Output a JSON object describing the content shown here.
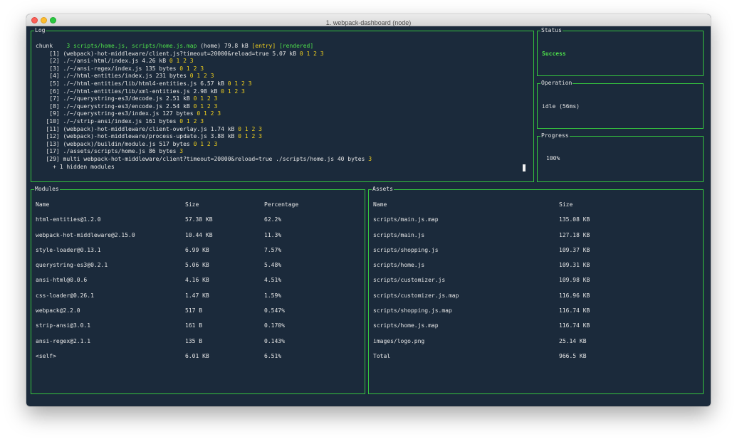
{
  "window": {
    "title": "1. webpack-dashboard (node)"
  },
  "log": {
    "label": "Log",
    "lines": [
      [
        {
          "t": "chunk    ",
          "c": "white"
        },
        {
          "t": "3 scripts/home.js, scripts/home.js.map",
          "c": "green"
        },
        {
          "t": " (home) 79.8 kB ",
          "c": "white"
        },
        {
          "t": "[entry]",
          "c": "yellow"
        },
        {
          "t": " ",
          "c": "white"
        },
        {
          "t": "[rendered]",
          "c": "green"
        }
      ],
      [
        {
          "t": "    [1] (webpack)-hot-middleware/client.js?timeout=20000&reload=true 5.07 kB ",
          "c": "white"
        },
        {
          "t": "0 1 2 3",
          "c": "yellow"
        }
      ],
      [
        {
          "t": "    [2] ./~/ansi-html/index.js 4.26 kB ",
          "c": "white"
        },
        {
          "t": "0 1 2 3",
          "c": "yellow"
        }
      ],
      [
        {
          "t": "    [3] ./~/ansi-regex/index.js 135 bytes ",
          "c": "white"
        },
        {
          "t": "0 1 2 3",
          "c": "yellow"
        }
      ],
      [
        {
          "t": "    [4] ./~/html-entities/index.js 231 bytes ",
          "c": "white"
        },
        {
          "t": "0 1 2 3",
          "c": "yellow"
        }
      ],
      [
        {
          "t": "    [5] ./~/html-entities/lib/html4-entities.js 6.57 kB ",
          "c": "white"
        },
        {
          "t": "0 1 2 3",
          "c": "yellow"
        }
      ],
      [
        {
          "t": "    [6] ./~/html-entities/lib/xml-entities.js 2.98 kB ",
          "c": "white"
        },
        {
          "t": "0 1 2 3",
          "c": "yellow"
        }
      ],
      [
        {
          "t": "    [7] ./~/querystring-es3/decode.js 2.51 kB ",
          "c": "white"
        },
        {
          "t": "0 1 2 3",
          "c": "yellow"
        }
      ],
      [
        {
          "t": "    [8] ./~/querystring-es3/encode.js 2.54 kB ",
          "c": "white"
        },
        {
          "t": "0 1 2 3",
          "c": "yellow"
        }
      ],
      [
        {
          "t": "    [9] ./~/querystring-es3/index.js 127 bytes ",
          "c": "white"
        },
        {
          "t": "0 1 2 3",
          "c": "yellow"
        }
      ],
      [
        {
          "t": "   [10] ./~/strip-ansi/index.js 161 bytes ",
          "c": "white"
        },
        {
          "t": "0 1 2 3",
          "c": "yellow"
        }
      ],
      [
        {
          "t": "   [11] (webpack)-hot-middleware/client-overlay.js 1.74 kB ",
          "c": "white"
        },
        {
          "t": "0 1 2 3",
          "c": "yellow"
        }
      ],
      [
        {
          "t": "   [12] (webpack)-hot-middleware/process-update.js 3.88 kB ",
          "c": "white"
        },
        {
          "t": "0 1 2 3",
          "c": "yellow"
        }
      ],
      [
        {
          "t": "   [13] (webpack)/buildin/module.js 517 bytes ",
          "c": "white"
        },
        {
          "t": "0 1 2 3",
          "c": "yellow"
        }
      ],
      [
        {
          "t": "   [17] ./assets/scripts/home.js 86 bytes ",
          "c": "white"
        },
        {
          "t": "3",
          "c": "yellow"
        }
      ],
      [
        {
          "t": "   [29] multi webpack-hot-middleware/client?timeout=20000&reload=true ./scripts/home.js 40 bytes ",
          "c": "white"
        },
        {
          "t": "3",
          "c": "yellow"
        }
      ],
      [
        {
          "t": "     + 1 hidden modules",
          "c": "white"
        }
      ]
    ]
  },
  "status": {
    "label": "Status",
    "value": "Success"
  },
  "operation": {
    "label": "Operation",
    "value": "idle (56ms)"
  },
  "progress": {
    "label": "Progress",
    "value": "100%"
  },
  "modules": {
    "label": "Modules",
    "headers": {
      "name": "Name",
      "size": "Size",
      "percentage": "Percentage"
    },
    "rows": [
      {
        "name": "html-entities@1.2.0",
        "size": "57.38 KB",
        "percentage": "62.2%"
      },
      {
        "name": "webpack-hot-middleware@2.15.0",
        "size": "10.44 KB",
        "percentage": "11.3%"
      },
      {
        "name": "style-loader@0.13.1",
        "size": "6.99 KB",
        "percentage": "7.57%"
      },
      {
        "name": "querystring-es3@0.2.1",
        "size": "5.06 KB",
        "percentage": "5.48%"
      },
      {
        "name": "ansi-html@0.0.6",
        "size": "4.16 KB",
        "percentage": "4.51%"
      },
      {
        "name": "css-loader@0.26.1",
        "size": "1.47 KB",
        "percentage": "1.59%"
      },
      {
        "name": "webpack@2.2.0",
        "size": "517 B",
        "percentage": "0.547%"
      },
      {
        "name": "strip-ansi@3.0.1",
        "size": "161 B",
        "percentage": "0.170%"
      },
      {
        "name": "ansi-regex@2.1.1",
        "size": "135 B",
        "percentage": "0.143%"
      },
      {
        "name": "<self>",
        "size": "6.01 KB",
        "percentage": "6.51%"
      }
    ]
  },
  "assets": {
    "label": "Assets",
    "headers": {
      "name": "Name",
      "size": "Size"
    },
    "rows": [
      {
        "name": "scripts/main.js.map",
        "size": "135.08 KB"
      },
      {
        "name": "scripts/main.js",
        "size": "127.18 KB"
      },
      {
        "name": "scripts/shopping.js",
        "size": "109.37 KB"
      },
      {
        "name": "scripts/home.js",
        "size": "109.31 KB"
      },
      {
        "name": "scripts/customizer.js",
        "size": "109.98 KB"
      },
      {
        "name": "scripts/customizer.js.map",
        "size": "116.96 KB"
      },
      {
        "name": "scripts/shopping.js.map",
        "size": "116.74 KB"
      },
      {
        "name": "scripts/home.js.map",
        "size": "116.74 KB"
      },
      {
        "name": "images/logo.png",
        "size": "25.14 KB"
      },
      {
        "name": "Total",
        "size": "966.5 KB"
      }
    ]
  },
  "colors": {
    "background": "#1b2a3b",
    "border": "#35c43e",
    "text": "#e6e6e6",
    "green": "#4ee04b",
    "yellow": "#f3d21d"
  }
}
